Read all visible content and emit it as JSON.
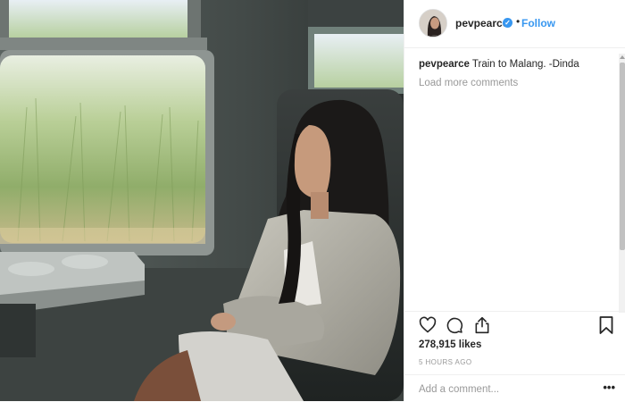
{
  "post": {
    "username": "pevpearce",
    "verified": true,
    "follow_label": "Follow",
    "separator": "•",
    "caption_user": "pevpearce",
    "caption_text": "Train to Malang. -Dinda",
    "load_more_label": "Load more comments",
    "likes": "278,915 likes",
    "timestamp": "5 HOURS AGO",
    "add_comment_placeholder": "Add a comment...",
    "more_options": "•••"
  },
  "icons": {
    "verified": "verified-check-icon",
    "like": "heart-icon",
    "comment": "comment-bubble-icon",
    "share": "share-icon",
    "save": "bookmark-icon",
    "more": "more-options-icon"
  },
  "colors": {
    "link_blue": "#3897f0",
    "text": "#262626",
    "muted": "#999999",
    "divider": "#efefef"
  }
}
